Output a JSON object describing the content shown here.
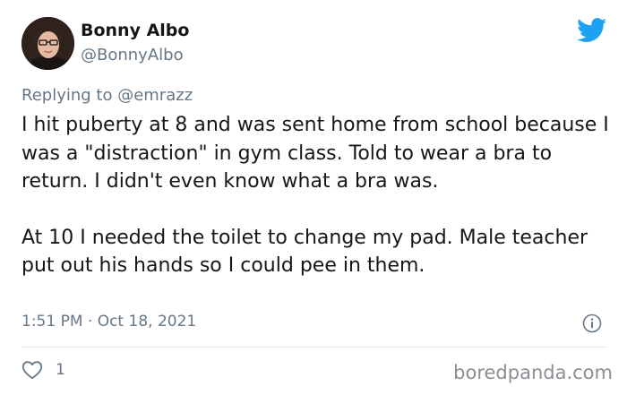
{
  "author": {
    "display_name": "Bonny Albo",
    "handle": "@BonnyAlbo"
  },
  "reply": {
    "prefix": "Replying to ",
    "mention": "@emrazz"
  },
  "tweet": {
    "paragraphs": [
      "I hit puberty at 8 and was sent home from school because I was a \"distraction\" in gym class. Told to wear a bra to return. I didn't even know what a bra was.",
      "At 10 I needed the toilet to change my pad. Male teacher put out his hands so I could pee in them."
    ],
    "timestamp": "1:51 PM · Oct 18, 2021"
  },
  "actions": {
    "like_count": "1"
  },
  "watermark": "boredpanda.com",
  "icons": {
    "logo": "twitter-bird-icon",
    "info": "info-icon",
    "like": "heart-icon"
  },
  "colors": {
    "twitter_blue": "#1da1f2",
    "secondary_text": "#657786",
    "primary_text": "#14171a",
    "divider": "#e1e8ed"
  }
}
